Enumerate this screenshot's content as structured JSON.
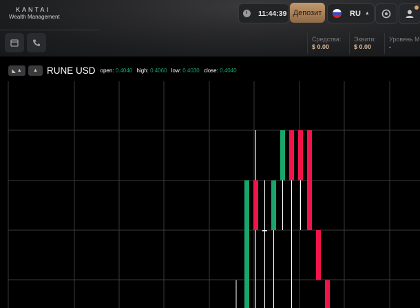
{
  "brand": {
    "name": "KANTAI",
    "subtitle": "Wealth Management"
  },
  "header": {
    "time": "11:44:39",
    "deposit_label": "Депозит",
    "language_code": "RU",
    "icons": {
      "clock": "clock-icon",
      "support": "support-icon",
      "profile": "user-icon",
      "calendar": "calendar-icon",
      "phone": "phone-icon"
    }
  },
  "stats": [
    {
      "label": "Средства:",
      "value": "$ 0.00"
    },
    {
      "label": "Эквити:",
      "value": "$ 0.00"
    },
    {
      "label": "Уровень М",
      "value": "-"
    }
  ],
  "chart": {
    "symbol": "RUNE USD",
    "open_label": "open:",
    "open": "0.4040",
    "high_label": "high:",
    "high": "0.4060",
    "low_label": "low:",
    "low": "0.4030",
    "close_label": "close:",
    "close": "0.4040",
    "colors": {
      "up": "#19a56b",
      "down": "#f0144a",
      "grid": "#3a3a3a"
    }
  },
  "chart_data": {
    "type": "candlestick",
    "series": [
      {
        "open": 0.401,
        "close": 0.405,
        "low": 0.4005,
        "high": 0.405
      },
      {
        "open": 0.405,
        "close": 0.404,
        "low": 0.402,
        "high": 0.406
      },
      {
        "open": 0.404,
        "close": 0.404,
        "low": 0.402,
        "high": 0.405
      },
      {
        "open": 0.404,
        "close": 0.405,
        "low": 0.402,
        "high": 0.405
      },
      {
        "open": 0.405,
        "close": 0.406,
        "low": 0.404,
        "high": 0.406
      },
      {
        "open": 0.406,
        "close": 0.405,
        "low": 0.402,
        "high": 0.406
      },
      {
        "open": 0.406,
        "close": 0.405,
        "low": 0.404,
        "high": 0.406
      },
      {
        "open": 0.406,
        "close": 0.404,
        "low": 0.404,
        "high": 0.406
      },
      {
        "open": 0.404,
        "close": 0.403,
        "low": 0.403,
        "high": 0.404
      },
      {
        "open": 0.403,
        "close": 0.402,
        "low": 0.402,
        "high": 0.403
      }
    ]
  }
}
